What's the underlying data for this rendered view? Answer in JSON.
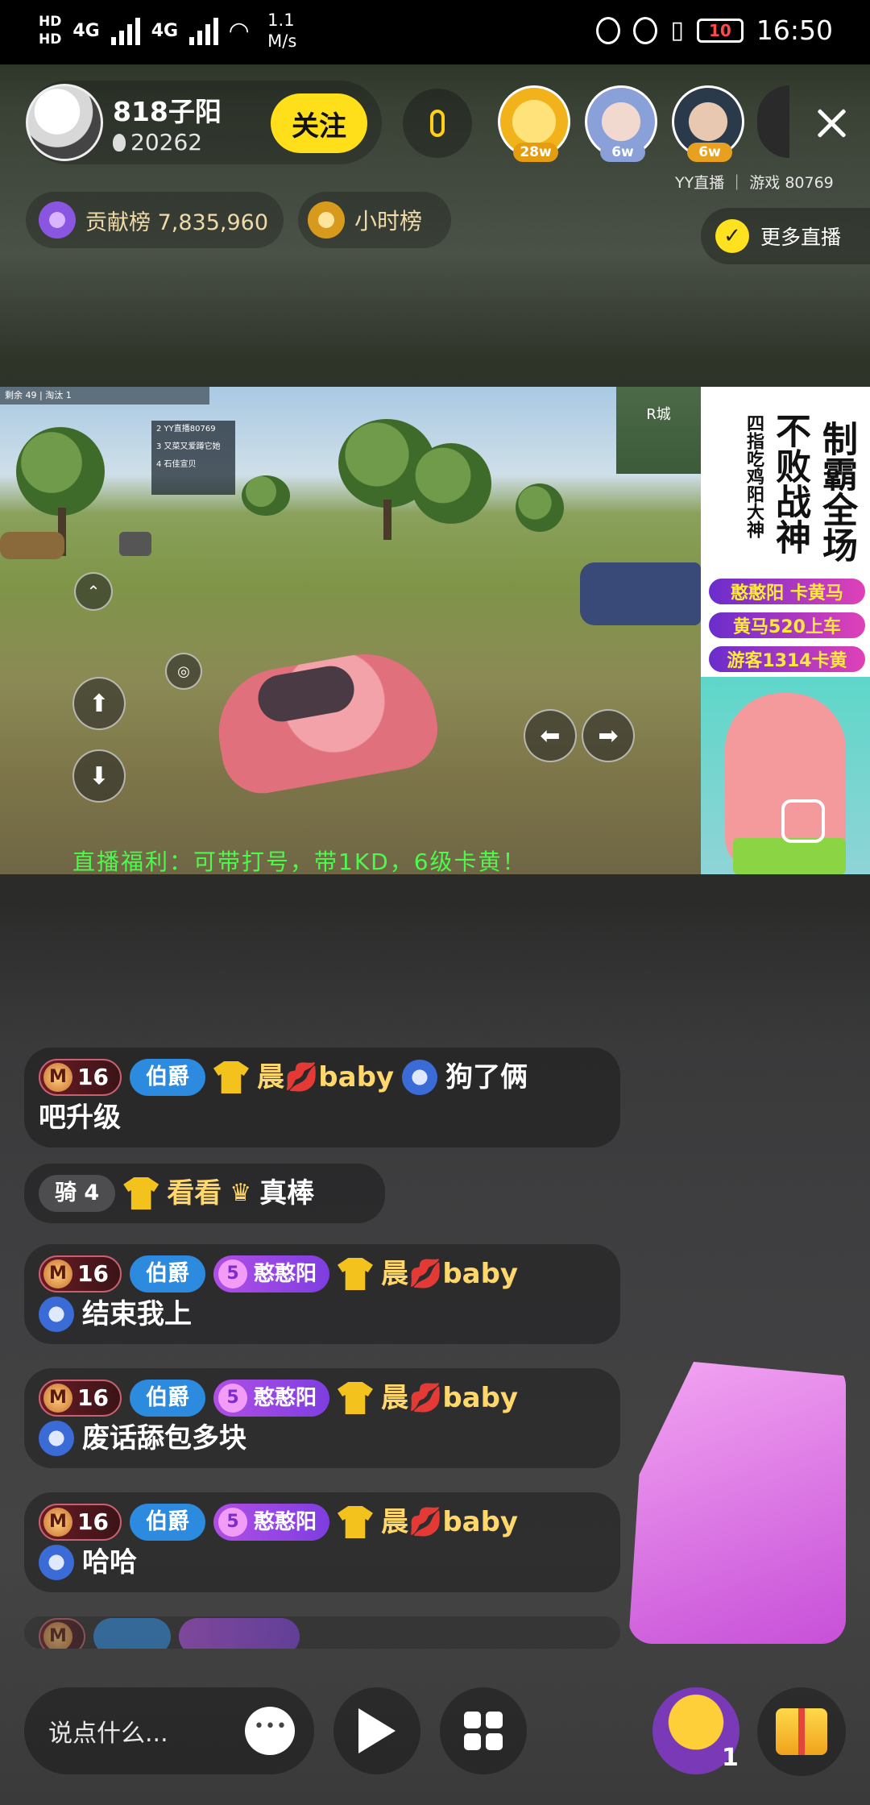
{
  "status_bar": {
    "hd1": "HD",
    "hd2": "HD",
    "sim1": "4G",
    "sim2": "4G",
    "speed_value": "1.1",
    "speed_unit": "M/s",
    "battery": "10",
    "time": "16:50"
  },
  "header": {
    "anchor_name": "818子阳",
    "heat_count": "20262",
    "follow_label": "关注",
    "viewers": [
      {
        "badge": "28w",
        "color": "#f2b21c"
      },
      {
        "badge": "6w",
        "color": "#8aa0d8"
      },
      {
        "badge": "6w",
        "color": "#e8a020"
      }
    ],
    "channel_info": "YY直播 ｜ 游戏 80769",
    "contribution_label": "贡献榜 7,835,960",
    "hourly_label": "小时榜",
    "more_live_label": "更多直播"
  },
  "video": {
    "ticker": "直播福利：可带打号，带1KD，6级卡黄！",
    "minimap_label": "R城",
    "hud_text": "剩余 49 | 淘汰 1",
    "kill_list": [
      "2 YY直播80769",
      "3 又菜又爱蹲它她",
      "4 石佳宣贝"
    ]
  },
  "poster": {
    "title_col1": "不败战神",
    "title_col2": "制霸全场",
    "subtitle": "四指吃鸡阳大神",
    "rows": [
      "憨憨阳 卡黄马",
      "黄马520上车",
      "游客1314卡黄"
    ]
  },
  "chat": {
    "messages": [
      {
        "level": "16",
        "rank": "伯爵",
        "name": "晨💋baby",
        "text": "狗了俩",
        "text2": "吧升级"
      },
      {
        "knight": "骑 4",
        "name": "看看",
        "text": "真棒"
      },
      {
        "level": "16",
        "rank": "伯爵",
        "fan_level": "5",
        "fan_name": "憨憨阳",
        "name": "晨💋baby",
        "text": "结束我上"
      },
      {
        "level": "16",
        "rank": "伯爵",
        "fan_level": "5",
        "fan_name": "憨憨阳",
        "name": "晨💋baby",
        "text": "废话舔包多块"
      },
      {
        "level": "16",
        "rank": "伯爵",
        "fan_level": "5",
        "fan_name": "憨憨阳",
        "name": "晨💋baby",
        "text": "哈哈"
      }
    ]
  },
  "bottom_bar": {
    "input_placeholder": "说点什么...",
    "mascot_count": "1"
  }
}
